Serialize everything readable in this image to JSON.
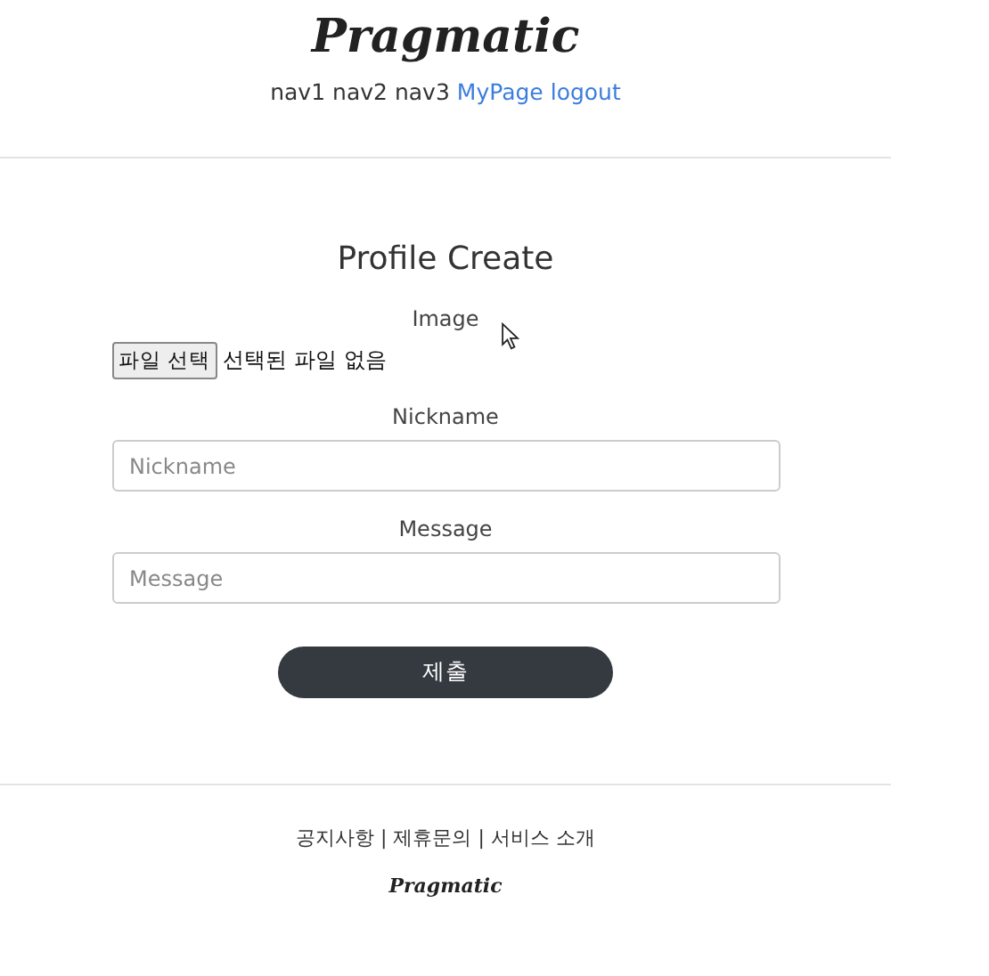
{
  "header": {
    "logo": "Pragmatic",
    "nav": [
      {
        "label": "nav1",
        "kind": "plain"
      },
      {
        "label": "nav2",
        "kind": "plain"
      },
      {
        "label": "nav3",
        "kind": "plain"
      },
      {
        "label": "MyPage",
        "kind": "link"
      },
      {
        "label": "logout",
        "kind": "link"
      }
    ]
  },
  "form": {
    "title": "Profile Create",
    "fields": [
      {
        "kind": "file",
        "label": "Image",
        "button": "파일 선택",
        "status": "선택된 파일 없음"
      },
      {
        "kind": "text",
        "label": "Nickname",
        "placeholder": "Nickname"
      },
      {
        "kind": "text",
        "label": "Message",
        "placeholder": "Message"
      }
    ],
    "submit": "제출"
  },
  "footer": {
    "links": "공지사항 | 제휴문의 | 서비스 소개",
    "logo": "Pragmatic"
  }
}
